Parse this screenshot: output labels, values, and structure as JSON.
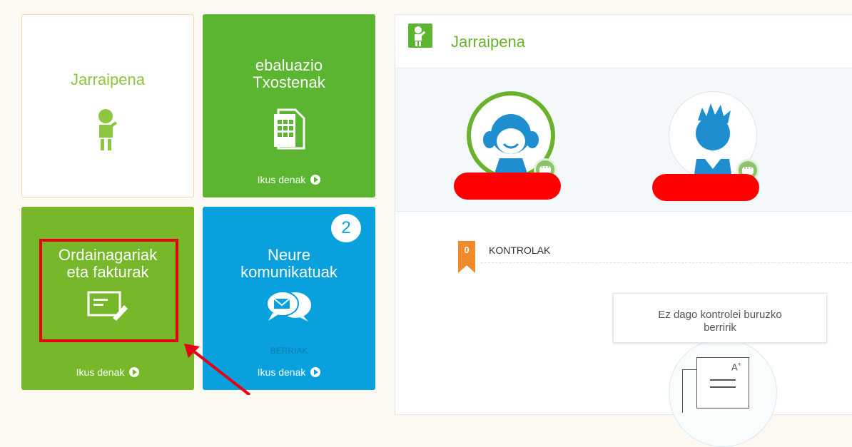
{
  "tiles": {
    "jarraipena": {
      "title": "Jarraipena",
      "color": "#8dc63f"
    },
    "ebaluazio": {
      "title_line1": "ebaluazio",
      "title_line2": "Txostenak",
      "link": "Ikus denak",
      "color": "#5cb531"
    },
    "ordainagariak": {
      "title_line1": "Ordainagariak",
      "title_line2": "eta fakturak",
      "link": "Ikus denak",
      "color": "#76b82a"
    },
    "komunikatuak": {
      "title_line1": "Neure",
      "title_line2": "komunikatuak",
      "badge": "2",
      "status": "BERRIAK",
      "link": "Ikus denak",
      "color": "#09a0de"
    }
  },
  "panel": {
    "title": "Jarraipena",
    "kontrolak_count": "0",
    "kontrolak_label": "KONTROLAK",
    "notice_line1": "Ez dago kontrolei buruzko",
    "notice_line2": "berririk"
  },
  "colors": {
    "accent_green": "#6ab12d",
    "redaction": "#ff0000",
    "highlight": "#e60012",
    "ribbon": "#f08a2c"
  }
}
